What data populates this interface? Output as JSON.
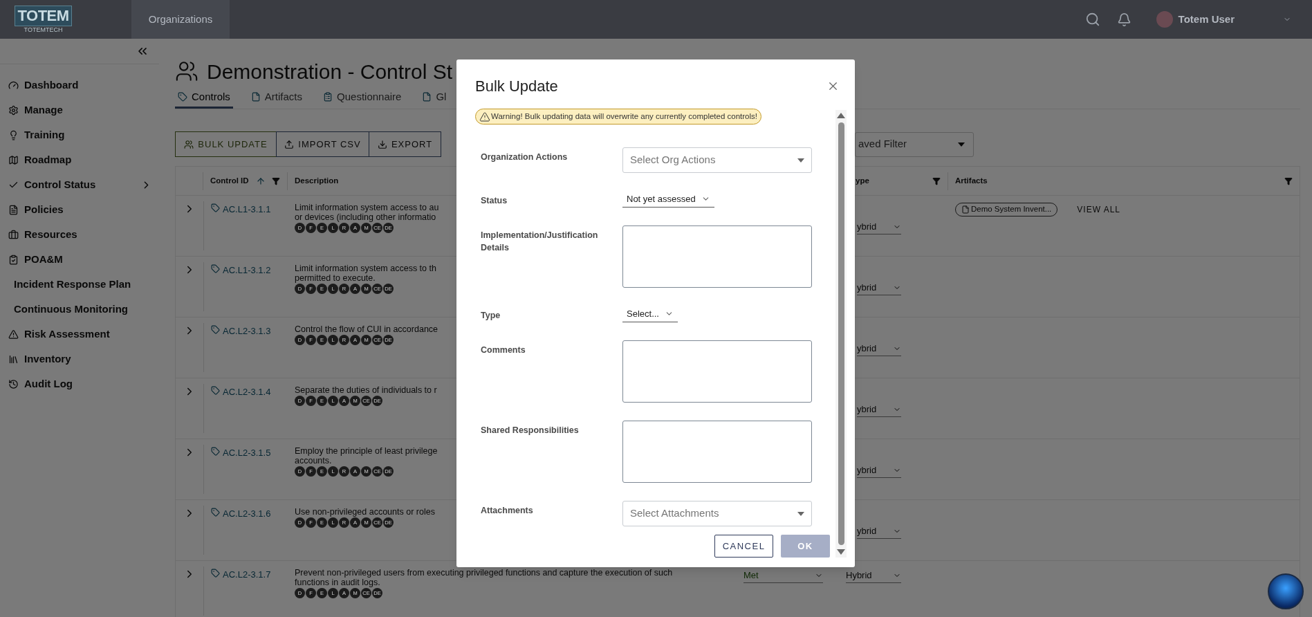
{
  "header": {
    "logo": {
      "text": "TOTEM",
      "subtext": "TOTEMTECH"
    },
    "nav": [
      {
        "label": "Organizations",
        "selected": true
      }
    ],
    "user": {
      "name": "Totem User"
    }
  },
  "sidebar": {
    "items": [
      {
        "label": "Dashboard",
        "expandable": false
      },
      {
        "label": "Manage",
        "expandable": false
      },
      {
        "label": "Training",
        "expandable": false
      },
      {
        "label": "Roadmap",
        "expandable": false
      },
      {
        "label": "Control Status",
        "expandable": true
      },
      {
        "label": "Policies",
        "expandable": false
      },
      {
        "label": "Resources",
        "expandable": false
      },
      {
        "label": "POA&M",
        "expandable": false
      },
      {
        "label": "Incident Response Plan",
        "expandable": false
      },
      {
        "label": "Continuous Monitoring",
        "expandable": false
      },
      {
        "label": "Risk Assessment",
        "expandable": false
      },
      {
        "label": "Inventory",
        "expandable": false
      },
      {
        "label": "Audit Log",
        "expandable": false
      }
    ]
  },
  "page": {
    "title": "Demonstration - Control St",
    "tabs": [
      {
        "label": "Controls",
        "selected": true
      },
      {
        "label": "Artifacts",
        "selected": false
      },
      {
        "label": "Questionnaire",
        "selected": false
      },
      {
        "label": "Gl",
        "selected": false
      }
    ],
    "toolbar": [
      {
        "label": "BULK UPDATE",
        "kind": "primary"
      },
      {
        "label": "IMPORT CSV",
        "kind": "secondary"
      },
      {
        "label": "EXPORT",
        "kind": "secondary"
      }
    ],
    "saved_filter": {
      "placeholder": "aved Filter"
    }
  },
  "table": {
    "columns": [
      {
        "label": "Control ID",
        "sorted": true,
        "filter": true
      },
      {
        "label": "Description",
        "sorted": false,
        "filter": false
      },
      {
        "label": "ype",
        "sorted": false,
        "filter": true
      },
      {
        "label": "Artifacts",
        "sorted": false,
        "filter": true
      }
    ],
    "rows": [
      {
        "id": "AC.L1-3.1.1",
        "description": [
          "Limit information system access to au",
          "or devices (including other informatio"
        ],
        "badges": [
          "D",
          "F",
          "E",
          "L",
          "R",
          "A",
          "M",
          "CE",
          "DE"
        ],
        "status": "",
        "type": "ybrid",
        "artifacts": [
          {
            "label": "Demo System Invent..."
          }
        ],
        "view_all": "VIEW ALL"
      },
      {
        "id": "AC.L1-3.1.2",
        "description": [
          "Limit information system access to th",
          "permitted to execute."
        ],
        "badges": [
          "D",
          "F",
          "E",
          "L",
          "R",
          "A",
          "M",
          "CE",
          "DE"
        ],
        "status": "",
        "type": "ybrid"
      },
      {
        "id": "AC.L2-3.1.3",
        "description": [
          "Control the flow of CUI in accordance"
        ],
        "badges": [
          "D",
          "F",
          "E",
          "L",
          "R",
          "A",
          "M",
          "CE",
          "DE"
        ],
        "status": "",
        "type": "ybrid"
      },
      {
        "id": "AC.L2-3.1.4",
        "description": [
          "Separate the duties of individuals to r"
        ],
        "badges": [
          "D",
          "F",
          "E",
          "L",
          "A",
          "M",
          "CE",
          "DE"
        ],
        "status": "",
        "type": "ybrid"
      },
      {
        "id": "AC.L2-3.1.5",
        "description": [
          "Employ the principle of least privilege",
          "accounts."
        ],
        "badges": [
          "D",
          "F",
          "E",
          "L",
          "R",
          "A",
          "M",
          "CE",
          "DE"
        ],
        "status": "",
        "type": "ybrid"
      },
      {
        "id": "AC.L2-3.1.6",
        "description": [
          "Use non-privileged accounts or roles"
        ],
        "badges": [
          "D",
          "F",
          "E",
          "L",
          "R",
          "A",
          "M",
          "CE",
          "DE"
        ],
        "status": "",
        "type": "ybrid"
      },
      {
        "id": "AC.L2-3.1.7",
        "description": [
          "Prevent non-privileged users from executing privileged functions and capture the execution of such",
          "functions in audit logs."
        ],
        "badges": [
          "D",
          "F",
          "E",
          "L",
          "A",
          "M",
          "CE",
          "DE"
        ],
        "status": "Met",
        "type": "Hybrid"
      }
    ]
  },
  "modal": {
    "title": "Bulk Update",
    "warning": "Warning! Bulk updating data will overwrite any currently completed controls!",
    "fields": [
      {
        "label": "Organization Actions",
        "kind": "select",
        "placeholder": "Select Org Actions"
      },
      {
        "label": "Status",
        "kind": "dropdown",
        "value": "Not yet assessed"
      },
      {
        "label": "Implementation/Justification Details",
        "kind": "textarea"
      },
      {
        "label": "Type",
        "kind": "dropdown",
        "value": "Select..."
      },
      {
        "label": "Comments",
        "kind": "textarea"
      },
      {
        "label": "Shared Responsibilities",
        "kind": "textarea"
      },
      {
        "label": "Attachments",
        "kind": "select",
        "placeholder": "Select Attachments"
      }
    ],
    "buttons": [
      {
        "label": "CANCEL",
        "disabled": false
      },
      {
        "label": "OK",
        "disabled": true
      }
    ]
  }
}
